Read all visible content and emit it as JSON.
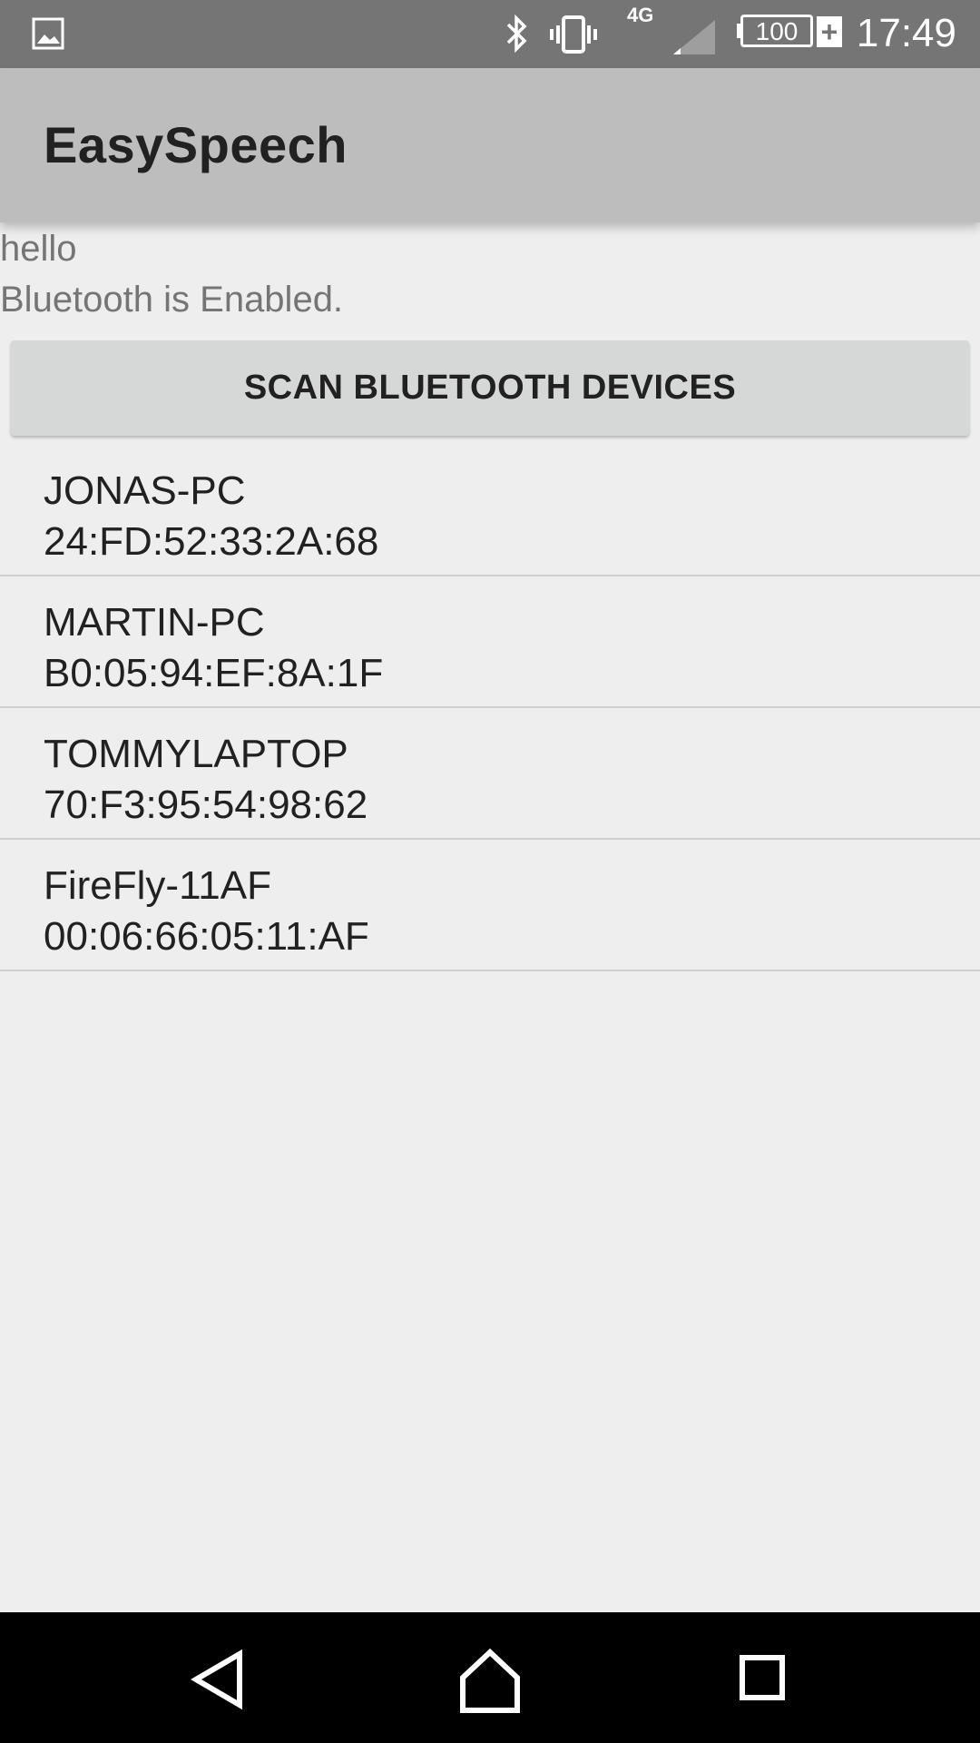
{
  "status_bar": {
    "network_type": "4G",
    "battery_level": "100",
    "time": "17:49",
    "icons": [
      "gallery-icon",
      "bluetooth-icon",
      "vibrate-icon",
      "signal-icon",
      "battery-icon",
      "charging-plus-icon"
    ]
  },
  "app_bar": {
    "title": "EasySpeech"
  },
  "main": {
    "hello_text": "hello",
    "bluetooth_status": "Bluetooth is Enabled.",
    "scan_button_label": "SCAN BLUETOOTH DEVICES",
    "devices": [
      {
        "name": "JONAS-PC",
        "address": "24:FD:52:33:2A:68"
      },
      {
        "name": "MARTIN-PC",
        "address": "B0:05:94:EF:8A:1F"
      },
      {
        "name": "TOMMYLAPTOP",
        "address": "70:F3:95:54:98:62"
      },
      {
        "name": "FireFly-11AF",
        "address": "00:06:66:05:11:AF"
      }
    ]
  },
  "nav_bar": {
    "icons": [
      "back-icon",
      "home-icon",
      "recents-icon"
    ]
  },
  "colors": {
    "status_bar_bg": "#757575",
    "app_bar_bg": "#bdbdbd",
    "background": "#eeeeee",
    "button_bg": "#d6d7d7",
    "nav_bar_bg": "#000000"
  }
}
